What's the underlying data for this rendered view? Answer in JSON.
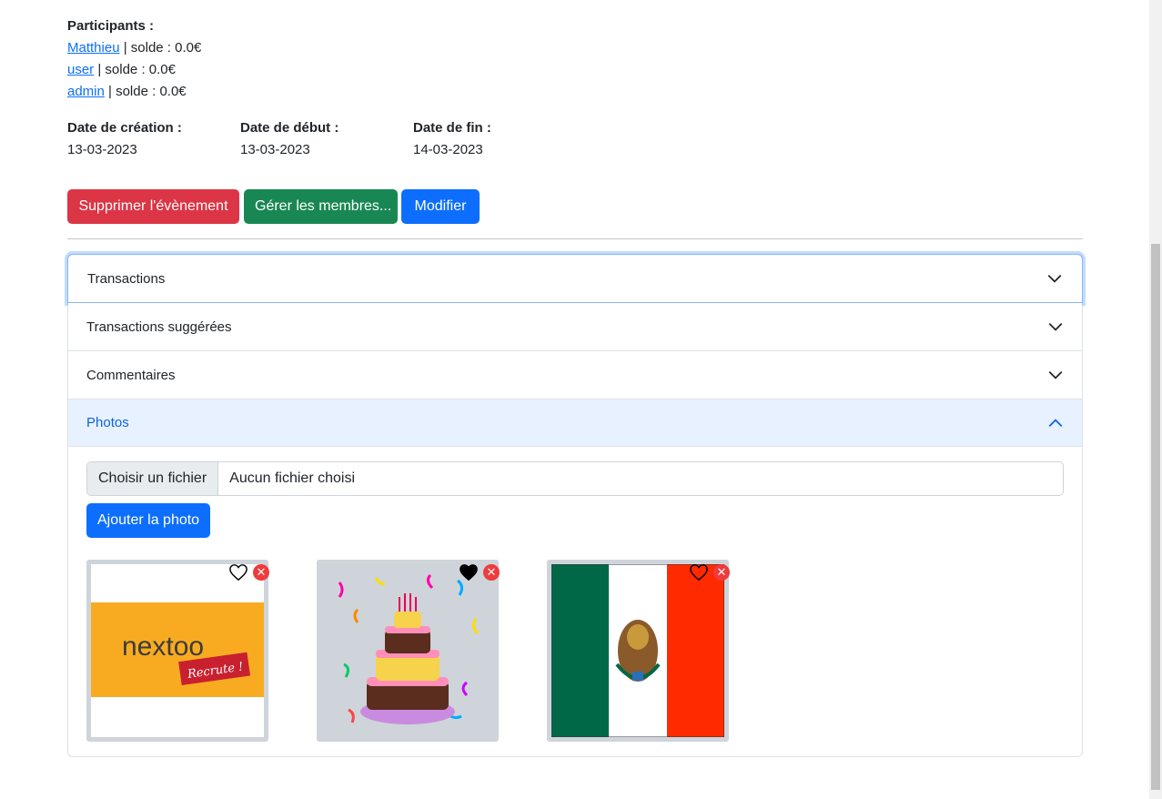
{
  "participants": {
    "title": "Participants :",
    "items": [
      {
        "name": "Matthieu",
        "balance": " | solde : 0.0€"
      },
      {
        "name": "user",
        "balance": " | solde : 0.0€"
      },
      {
        "name": "admin",
        "balance": " | solde : 0.0€"
      }
    ]
  },
  "dates": {
    "creation_label": "Date de création :",
    "creation_value": "13-03-2023",
    "start_label": "Date de début :",
    "start_value": "13-03-2023",
    "end_label": "Date de fin :",
    "end_value": "14-03-2023"
  },
  "actions": {
    "delete_label": "Supprimer l'évènement",
    "members_label": "Gérer les membres...",
    "edit_label": "Modifier"
  },
  "accordion": {
    "items": [
      {
        "label": "Transactions"
      },
      {
        "label": "Transactions suggérées"
      },
      {
        "label": "Commentaires"
      },
      {
        "label": "Photos"
      }
    ]
  },
  "photos": {
    "file_button": "Choisir un fichier",
    "file_status": "Aucun fichier choisi",
    "add_label": "Ajouter la photo",
    "logo_text": "nextoo",
    "logo_subtext": "Recrute !",
    "items": [
      {
        "subject": "nextoo logo",
        "liked": false
      },
      {
        "subject": "birthday cake",
        "liked": true
      },
      {
        "subject": "Mexico flag",
        "liked": false
      }
    ]
  },
  "colors": {
    "danger": "#dc3545",
    "success": "#198754",
    "primary": "#0d6efd",
    "accordion_open_bg": "#e7f1ff"
  }
}
